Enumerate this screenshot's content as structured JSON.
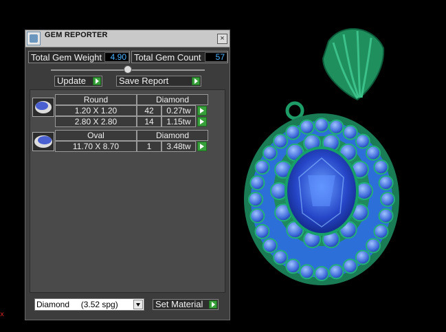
{
  "panel": {
    "title": "GEM REPORTER",
    "total_weight_label": "Total Gem Weight",
    "total_weight_value": "4.90",
    "total_count_label": "Total Gem Count",
    "total_count_value": "57",
    "update_label": "Update",
    "save_report_label": "Save Report",
    "material_select": "Diamond     (3.52 spg)",
    "set_material_label": "Set Material"
  },
  "gems": [
    {
      "shape": "Round",
      "material": "Diamond",
      "icon": "round-gem-icon",
      "sizes": [
        {
          "size": "1.20 X 1.20",
          "count": "42",
          "weight": "0.27tw"
        },
        {
          "size": "2.80 X 2.80",
          "count": "14",
          "weight": "1.15tw"
        }
      ]
    },
    {
      "shape": "Oval",
      "material": "Diamond",
      "icon": "oval-gem-icon",
      "sizes": [
        {
          "size": "11.70 X 8.70",
          "count": "1",
          "weight": "3.48tw"
        }
      ]
    }
  ],
  "viewport": {
    "axis_label": "x",
    "gem_color": "#2a4fcf",
    "metal_color": "#1e9c68"
  }
}
